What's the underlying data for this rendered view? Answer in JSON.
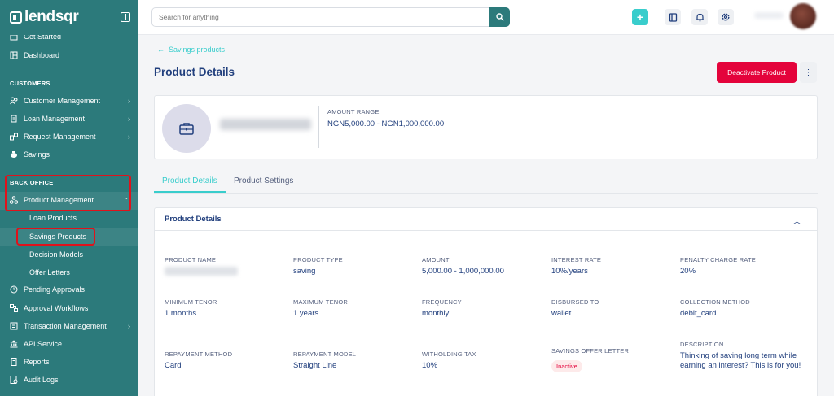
{
  "sidebar": {
    "brand": "lendsqr",
    "top_items": [
      {
        "label": "Get Started"
      },
      {
        "label": "Dashboard"
      }
    ],
    "customers_label": "CUSTOMERS",
    "customer_items": [
      {
        "label": "Customer Management"
      },
      {
        "label": "Loan Management"
      },
      {
        "label": "Request Management"
      },
      {
        "label": "Savings"
      }
    ],
    "back_office_label": "BACK OFFICE",
    "product_management": "Product Management",
    "product_sub_items": [
      {
        "label": "Loan Products"
      },
      {
        "label": "Savings Products"
      },
      {
        "label": "Decision Models"
      },
      {
        "label": "Offer Letters"
      }
    ],
    "bottom_items": [
      {
        "label": "Pending Approvals"
      },
      {
        "label": "Approval Workflows"
      },
      {
        "label": "Transaction Management"
      },
      {
        "label": "API Service"
      },
      {
        "label": "Reports"
      },
      {
        "label": "Audit Logs"
      }
    ]
  },
  "topbar": {
    "search_placeholder": "Search for anything"
  },
  "page": {
    "back_link": "Savings products",
    "title": "Product Details",
    "deactivate_label": "Deactivate Product",
    "amount_range_label": "AMOUNT RANGE",
    "amount_range_value": "NGN5,000.00 - NGN1,000,000.00"
  },
  "tabs": [
    {
      "label": "Product Details"
    },
    {
      "label": "Product Settings"
    }
  ],
  "details": {
    "section_title": "Product Details",
    "fields": [
      {
        "label": "PRODUCT NAME",
        "value": ""
      },
      {
        "label": "PRODUCT TYPE",
        "value": "saving"
      },
      {
        "label": "AMOUNT",
        "value": "5,000.00 - 1,000,000.00"
      },
      {
        "label": "INTEREST RATE",
        "value": "10%/years"
      },
      {
        "label": "PENALTY CHARGE RATE",
        "value": "20%"
      },
      {
        "label": "MINIMUM TENOR",
        "value": "1 months"
      },
      {
        "label": "MAXIMUM TENOR",
        "value": "1 years"
      },
      {
        "label": "FREQUENCY",
        "value": "monthly"
      },
      {
        "label": "DISBURSED TO",
        "value": "wallet"
      },
      {
        "label": "COLLECTION METHOD",
        "value": "debit_card"
      },
      {
        "label": "REPAYMENT METHOD",
        "value": "Card"
      },
      {
        "label": "REPAYMENT MODEL",
        "value": "Straight Line"
      },
      {
        "label": "WITHOLDING TAX",
        "value": "10%"
      },
      {
        "label": "SAVINGS OFFER LETTER",
        "value": "Inactive"
      },
      {
        "label": "DESCRIPTION",
        "value": "Thinking of saving long term while earning an interest? This is for you!"
      }
    ]
  },
  "colors": {
    "sidebar": "#2c7a7b",
    "accent": "#39cdcc",
    "danger": "#e4033b",
    "primary_text": "#213f7d"
  }
}
